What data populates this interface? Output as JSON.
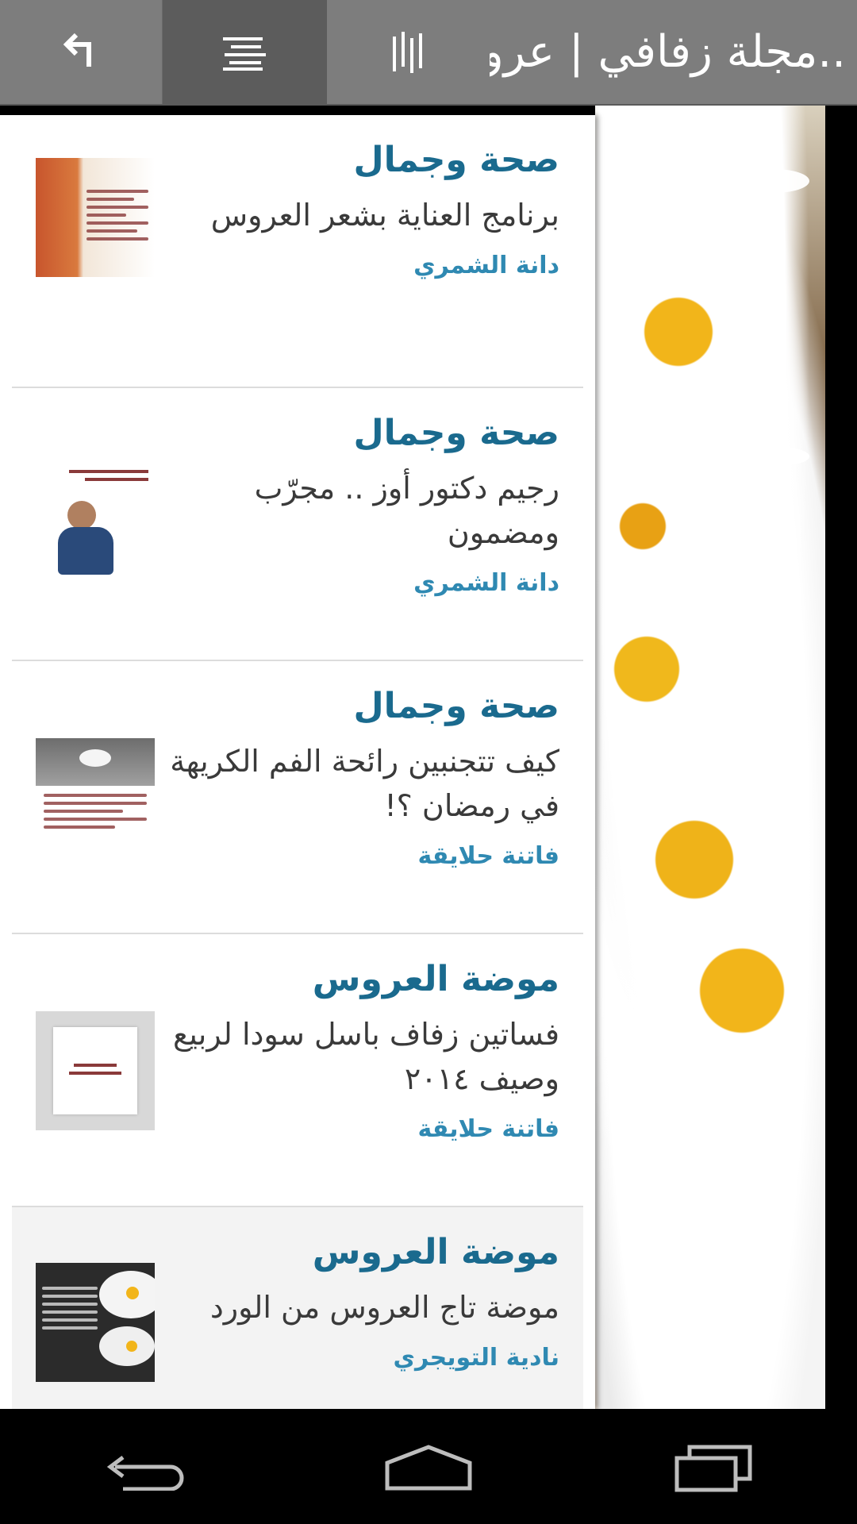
{
  "app_bar": {
    "title": "مجلة زفافي | عرو..",
    "buttons": {
      "back_icon": "back-arrow-icon",
      "list_icon": "list-lines-icon",
      "columns_icon": "columns-icon"
    }
  },
  "articles": [
    {
      "category": "صحة وجمال",
      "title": "برنامج العناية بشعر العروس",
      "author": "دانة الشمري"
    },
    {
      "category": "صحة وجمال",
      "title": "رجيم دكتور أوز .. مجرّب ومضمون",
      "author": "دانة الشمري"
    },
    {
      "category": "صحة وجمال",
      "title": "كيف تتجنبين رائحة الفم الكريهة في رمضان ؟!",
      "author": "فاتنة حلايقة"
    },
    {
      "category": "موضة العروس",
      "title": "فساتين زفاف باسل سودا لربيع وصيف ٢٠١٤",
      "author": "فاتنة حلايقة"
    },
    {
      "category": "موضة العروس",
      "title": "موضة تاج العروس من الورد",
      "author": "نادية التويجري"
    }
  ],
  "nav_bar": {
    "icons": [
      "back-icon",
      "home-icon",
      "recent-apps-icon"
    ]
  },
  "colors": {
    "category": "#1a6a8e",
    "author": "#2f89b2",
    "topbar": "#7d7d7d",
    "topbar_active": "#5c5c5c"
  }
}
